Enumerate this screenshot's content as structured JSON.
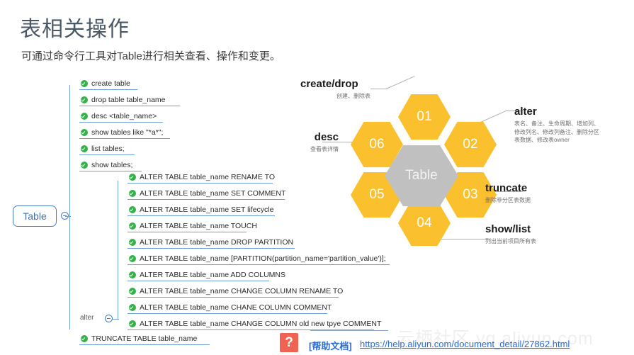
{
  "header": {
    "title": "表相关操作",
    "subtitle": "可通过命令行工具对Table进行相关查看、操作和变更。"
  },
  "mindmap": {
    "root_label": "Table",
    "branch_label": "alter",
    "top_items": [
      "create table",
      "drop table table_name",
      "desc <table_name>",
      "show tables like \"*a*\";",
      "list tables;",
      "show tables;"
    ],
    "alter_items": [
      "ALTER TABLE table_name RENAME TO",
      "ALTER TABLE table_name SET COMMENT",
      "ALTER TABLE table_name SET lifecycle",
      "ALTER TABLE table_name TOUCH",
      "ALTER TABLE table_name DROP PARTITION",
      "ALTER TABLE table_name [PARTITION(partition_name='partition_value')];",
      "ALTER TABLE table_name ADD COLUMNS",
      "ALTER TABLE table_name CHANGE COLUMN RENAME TO",
      "ALTER TABLE table_name CHANE COLUMN COMMENT",
      "ALTER TABLE table_name CHANGE COLUMN old new tpye COMMENT"
    ],
    "bottom_items": [
      "TRUNCATE TABLE table_name"
    ]
  },
  "honeycomb": {
    "center_label": "Table",
    "cells": [
      {
        "number": "01",
        "title": "create/drop",
        "desc": "创建、删除表"
      },
      {
        "number": "02",
        "title": "alter",
        "desc": "表名、备注、生命周期、增加列、修改列名、修改列备注、删除分区表数据、修改表owner"
      },
      {
        "number": "03",
        "title": "truncate",
        "desc": "删除非分区表数据"
      },
      {
        "number": "04",
        "title": "show/list",
        "desc": "列出当前项目所有表"
      },
      {
        "number": "05",
        "title": "",
        "desc": ""
      },
      {
        "number": "06",
        "title": "desc",
        "desc": "查看表详情"
      }
    ]
  },
  "footer": {
    "badge": "?",
    "help_label": "[帮助文档]",
    "url": "https://help.aliyun.com/document_detail/27862.html",
    "watermark": "云栖社区 yq.aliyun.com"
  },
  "colors": {
    "hex_fill": "#fbc02d",
    "hex_center": "#c0c0c0",
    "tree_line": "#6f9fd8",
    "check_green": "#35b14a",
    "link_blue": "#2b6cd4",
    "badge_red": "#ee6352"
  }
}
